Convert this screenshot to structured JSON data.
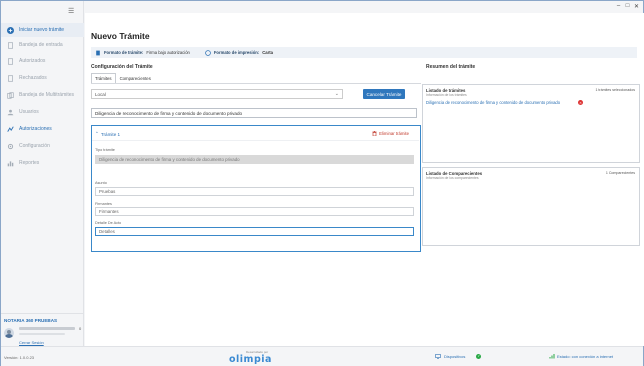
{
  "window": {
    "minimize": "–",
    "maximize": "□",
    "close": "✕"
  },
  "sidebar": {
    "items": [
      {
        "label": "Iniciar nuevo trámite"
      },
      {
        "label": "Bandeja de entrada"
      },
      {
        "label": "Autorizados"
      },
      {
        "label": "Rechazados"
      },
      {
        "label": "Bandeja de Multitrámites"
      },
      {
        "label": "Usuarios"
      },
      {
        "label": "Autorizaciones"
      },
      {
        "label": "Configuración"
      },
      {
        "label": "Reportes"
      }
    ],
    "notaria": {
      "title": "NOTARIA 360 PRUEBAS",
      "count": "0",
      "logout": "Cerrar Sesión"
    }
  },
  "main": {
    "title": "Nuevo Trámite",
    "infobar": {
      "format_label": "Formato de trámite:",
      "format_value": "Firma bajo autorización",
      "print_label": "Formato de impresión:",
      "print_value": "Carta"
    },
    "config": {
      "title": "Configuración del Trámite",
      "tabs": [
        "Trámites",
        "Comparecientes"
      ],
      "select_value": "Local",
      "cancel_button": "Cancelar Trámite",
      "tramite_name": "Diligencia de reconocimento de firma y contenido de documento privado",
      "tramite": {
        "header": "Trámite 1",
        "delete": "Eliminar trámite",
        "tipo_label": "Tipo trámite",
        "tipo_value": "Diligencia de reconocimento de firma y contenido de documento privado",
        "asunto_label": "Asunto",
        "asunto_value": "Pruebas",
        "firmantes_label": "Firmantes",
        "firmantes_value": "Firmantes",
        "detalle_label": "Detalle De Acto",
        "detalle_value": "Detalles"
      }
    },
    "summary": {
      "title": "Resumen del trámite",
      "tramites_card": {
        "title": "Listado de trámites",
        "subtitle": "Información de los trámites",
        "count": "1 trámites seleccionados",
        "item": "Diligencia de reconocimento de firma y contenido de documento privado"
      },
      "comparecientes_card": {
        "title": "Listado de Comparecientes",
        "subtitle": "Información de los comparecientes",
        "count": "1 Comparecientes"
      }
    }
  },
  "footer": {
    "version": "Versión: 1.0.0.23",
    "brand_small": "Desarrollado por",
    "brand": "olimpia",
    "dispositivos": "Dispositivos",
    "connection": "Estado: con conexión a internet"
  },
  "colors": {
    "accent": "#2f77bd",
    "danger": "#d33333",
    "success": "#27a844"
  }
}
